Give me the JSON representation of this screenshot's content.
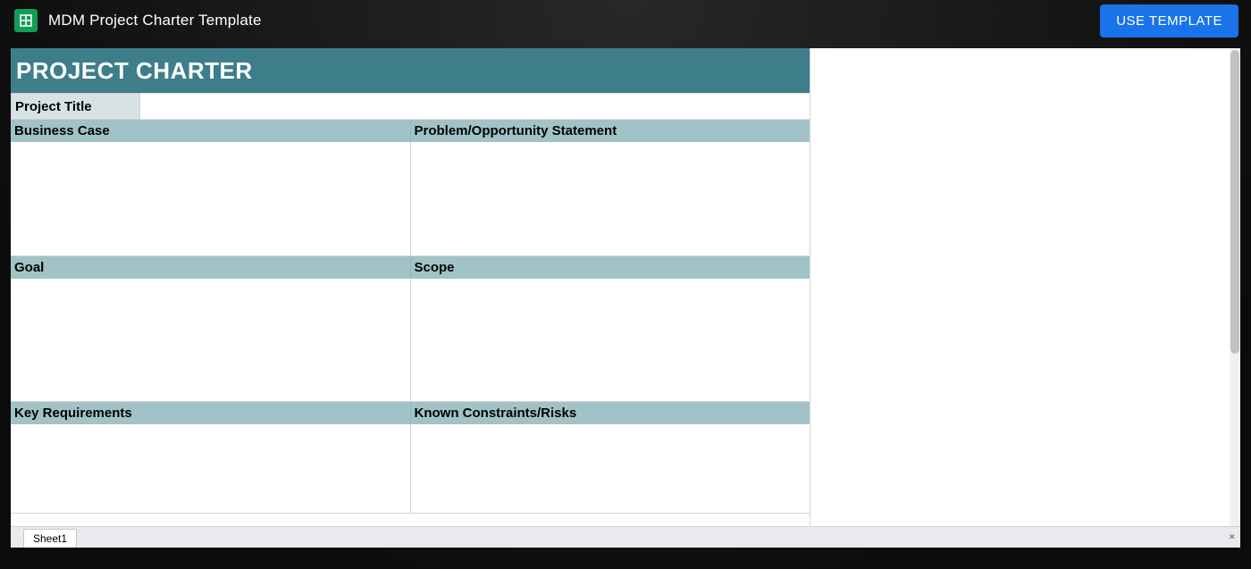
{
  "header": {
    "doc_title": "MDM Project Charter Template",
    "use_template_label": "USE TEMPLATE"
  },
  "spreadsheet": {
    "banner_title": "PROJECT CHARTER",
    "project_title_label": "Project Title",
    "project_title_value": "",
    "sections": [
      {
        "left": "Business Case",
        "right": "Problem/Opportunity Statement"
      },
      {
        "left": "Goal",
        "right": "Scope"
      },
      {
        "left": "Key Requirements",
        "right": "Known Constraints/Risks"
      }
    ],
    "tabs": [
      "Sheet1"
    ]
  },
  "colors": {
    "banner": "#3e7e8b",
    "section_header": "#a1c3c7",
    "title_label_bg": "#d7e2e3",
    "use_btn": "#1a73e8"
  }
}
